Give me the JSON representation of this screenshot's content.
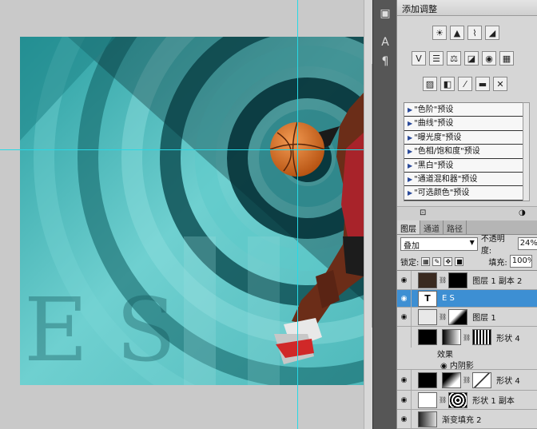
{
  "canvas": {
    "letters": [
      "E",
      "S"
    ],
    "bg_color": "#4fc2c2",
    "ring_dark": "#0b3c42",
    "ball_color": "#d86a22"
  },
  "toolstrip": {
    "tools": [
      "layer-comp-icon",
      "character-icon",
      "paragraph-icon"
    ],
    "glyphs": [
      "▣",
      "A",
      "¶"
    ]
  },
  "adjustments": {
    "title": "添加调整",
    "row1": [
      "☀",
      "▲",
      "⌇",
      "◢"
    ],
    "row2": [
      "V",
      "☰",
      "⚖",
      "◪",
      "◉",
      "▦"
    ],
    "row3": [
      "▨",
      "◧",
      "⁄",
      "▬",
      "✕"
    ],
    "presets": [
      "\"色阶\"预设",
      "\"曲线\"预设",
      "\"曝光度\"预设",
      "\"色相/饱和度\"预设",
      "\"黑白\"预设",
      "\"通道混和器\"预设",
      "\"可选颜色\"预设"
    ]
  },
  "layers_panel": {
    "tabs": [
      "图层",
      "通道",
      "路径"
    ],
    "blend_mode": "叠加",
    "opacity_label": "不透明度:",
    "opacity_value": "24%",
    "lock_label": "锁定:",
    "fill_label": "填充:",
    "fill_value": "100%",
    "layers": [
      {
        "name": "图层 1 副本 2",
        "selected": false
      },
      {
        "name": "E S",
        "selected": true
      },
      {
        "name": "图层 1",
        "selected": false
      },
      {
        "name": "形状 4",
        "selected": false
      },
      {
        "name": "形状 4",
        "selected": false
      },
      {
        "name": "形状 1 副本",
        "selected": false
      },
      {
        "name": "渐变填充 2",
        "selected": false
      }
    ],
    "effects_label": "效果",
    "inner_shadow_label": "内阴影",
    "type_glyph": "T"
  }
}
